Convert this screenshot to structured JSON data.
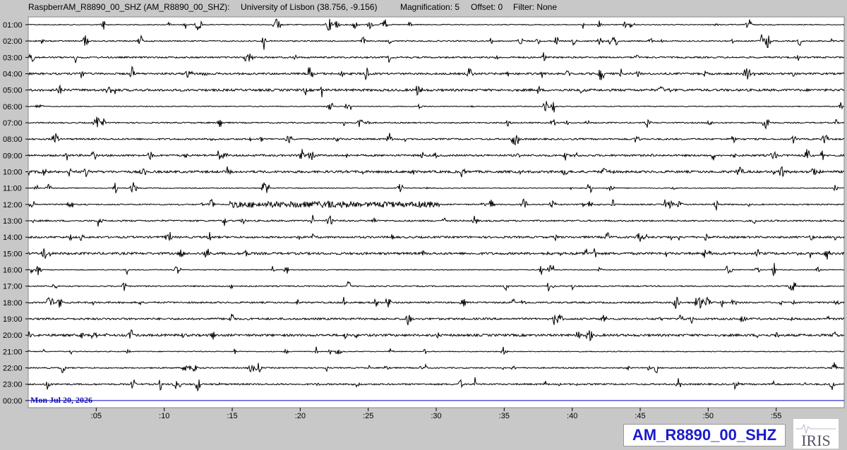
{
  "header": {
    "station": "RaspberrAM_R8890_00_SHZ (AM_R8890_00_SHZ):",
    "location": "University of Lisbon (38.756, -9.156)",
    "magnification": "Magnification: 5",
    "offset": "Offset: 0",
    "filter": "Filter: None"
  },
  "chart_data": {
    "type": "line",
    "description_kind": "helicorder",
    "row_labels": [
      "01:00",
      "02:00",
      "03:00",
      "04:00",
      "05:00",
      "06:00",
      "07:00",
      "08:00",
      "09:00",
      "10:00",
      "11:00",
      "12:00",
      "13:00",
      "14:00",
      "15:00",
      "16:00",
      "17:00",
      "18:00",
      "19:00",
      "20:00",
      "21:00",
      "22:00",
      "23:00",
      "00:00"
    ],
    "x_tick_labels": [
      ":05",
      ":10",
      ":15",
      ":20",
      ":25",
      ":30",
      ":35",
      ":40",
      ":45",
      ":50",
      ":55"
    ],
    "x_tick_minutes": [
      5,
      10,
      15,
      20,
      25,
      30,
      35,
      40,
      45,
      50,
      55
    ],
    "xlim": [
      0,
      60
    ],
    "date_label": "Mon Jul 20, 2026",
    "trace_color": "#000000",
    "current_row_color": "#0000cc",
    "last_row_index": 23,
    "grid": false
  },
  "footer": {
    "station_code": "AM_R8890_00_SHZ",
    "logo_text": "IRIS"
  },
  "colors": {
    "background": "#c8c8c8",
    "plot_background": "#ffffff",
    "station_text": "#1b1bcc",
    "date_text": "#1111aa"
  }
}
